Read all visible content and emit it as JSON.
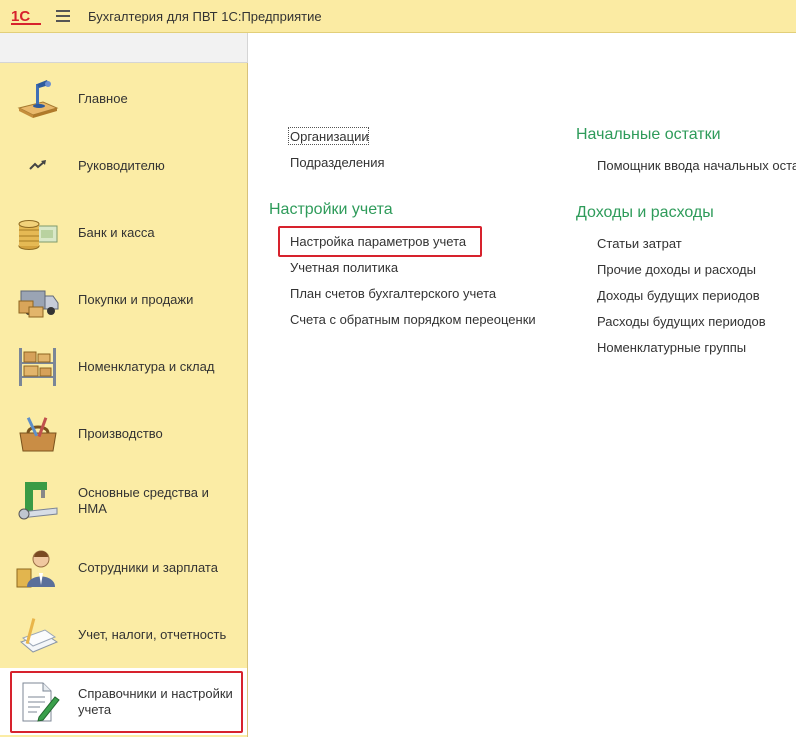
{
  "app": {
    "title": "Бухгалтерия для ПВТ 1С:Предприятие",
    "logo_text": "1С"
  },
  "sidebar": {
    "items": [
      {
        "label": "Главное",
        "icon": "desk-lamp-icon"
      },
      {
        "label": "Руководителю",
        "icon": "trend-icon"
      },
      {
        "label": "Банк и касса",
        "icon": "coins-icon"
      },
      {
        "label": "Покупки и продажи",
        "icon": "truck-icon"
      },
      {
        "label": "Номенклатура и склад",
        "icon": "warehouse-shelf-icon"
      },
      {
        "label": "Производство",
        "icon": "toolbox-icon"
      },
      {
        "label": "Основные средства и НМА",
        "icon": "machine-icon"
      },
      {
        "label": "Сотрудники и зарплата",
        "icon": "employee-icon"
      },
      {
        "label": "Учет, налоги, отчетность",
        "icon": "report-icon"
      },
      {
        "label": "Справочники и настройки учета",
        "icon": "document-pen-icon"
      }
    ],
    "active_index": 9
  },
  "content": {
    "left_column": {
      "links_top": [
        "Организации",
        "Подразделения"
      ],
      "group_title": "Настройки учета",
      "links": [
        "Настройка параметров учета",
        "Учетная политика",
        "План счетов бухгалтерского учета",
        "Счета с обратным порядком переоценки"
      ]
    },
    "right_column": {
      "group1_title": "Начальные остатки",
      "group1_links": [
        "Помощник ввода начальных оста"
      ],
      "group2_title": "Доходы и расходы",
      "group2_links": [
        "Статьи затрат",
        "Прочие доходы и расходы",
        "Доходы будущих периодов",
        "Расходы будущих периодов",
        "Номенклатурные группы"
      ]
    }
  },
  "colors": {
    "accent_green": "#2e9b5a",
    "highlight_red": "#d7222d",
    "sidebar_bg": "#fbeca5",
    "titlebar_bg": "#fbeba3",
    "logo_red": "#d7222d"
  }
}
